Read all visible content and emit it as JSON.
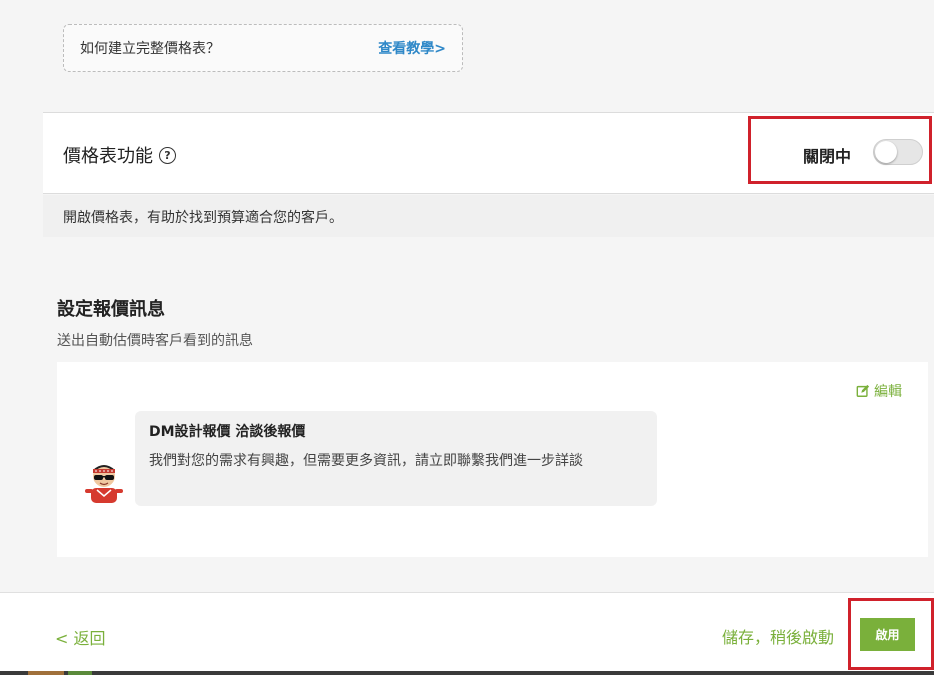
{
  "tutorial": {
    "question": "如何建立完整價格表？",
    "link": "查看教學>"
  },
  "feature": {
    "title": "價格表功能",
    "help_icon": "?",
    "toggle_label": "關閉中",
    "toggle_state": "off",
    "description": "開啟價格表，有助於找到預算適合您的客戶。"
  },
  "quote_message": {
    "title": "設定報價訊息",
    "subtitle": "送出自動估價時客戶看到的訊息",
    "edit_label": "編輯",
    "bubble_title": "DM設計報價 洽談後報價",
    "bubble_text": "我們對您的需求有興趣，但需要更多資訊，請立即聯繫我們進一步詳談"
  },
  "footer": {
    "back_label": "< 返回",
    "save_later_label": "儲存，稍後啟動",
    "enable_label": "啟用"
  },
  "colors": {
    "accent_green": "#7ab03b",
    "link_blue": "#2f88c8",
    "highlight_red": "#d0212b"
  }
}
